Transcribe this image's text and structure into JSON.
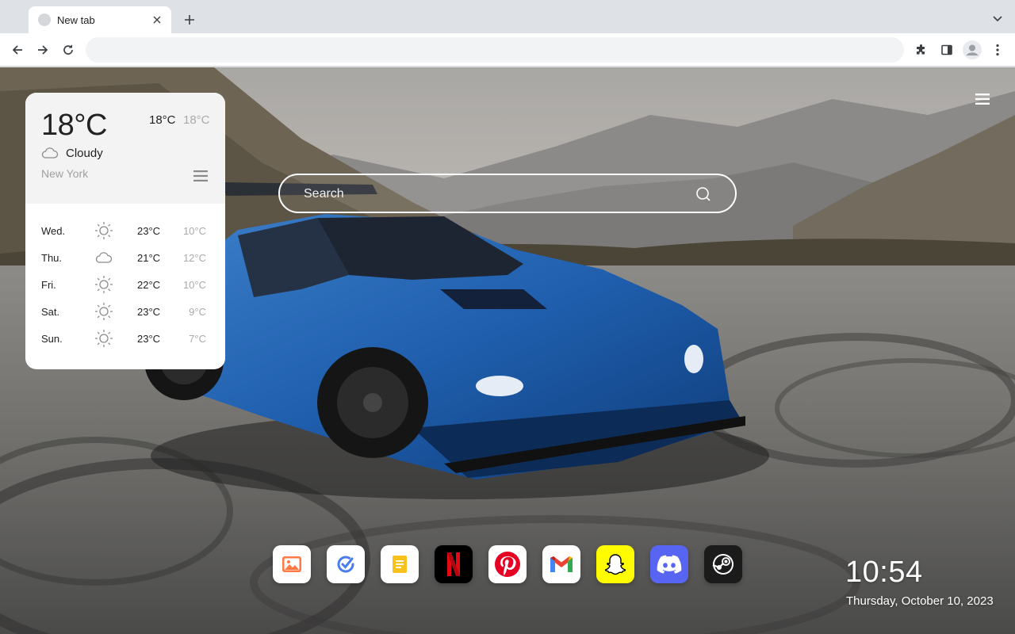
{
  "browser": {
    "tab_title": "New tab",
    "omnibox_value": "",
    "icons": [
      "back-icon",
      "forward-icon",
      "reload-icon",
      "extensions-icon",
      "side-panel-icon",
      "profile-icon",
      "more-icon"
    ]
  },
  "weather": {
    "current_temp": "18°C",
    "high": "18°C",
    "low": "18°C",
    "condition": "Cloudy",
    "condition_icon": "cloud-icon",
    "city": "New York",
    "forecast": [
      {
        "day": "Wed.",
        "icon": "sun-icon",
        "high": "23°C",
        "low": "10°C"
      },
      {
        "day": "Thu.",
        "icon": "cloud-icon",
        "high": "21°C",
        "low": "12°C"
      },
      {
        "day": "Fri.",
        "icon": "sun-icon",
        "high": "22°C",
        "low": "10°C"
      },
      {
        "day": "Sat.",
        "icon": "sun-icon",
        "high": "23°C",
        "low": "9°C"
      },
      {
        "day": "Sun.",
        "icon": "sun-icon",
        "high": "23°C",
        "low": "7°C"
      }
    ]
  },
  "search": {
    "placeholder": "Search"
  },
  "dock": [
    {
      "name": "gallery",
      "icon": "photos-app-icon",
      "color": "#ff6a3d"
    },
    {
      "name": "tasks",
      "icon": "tasks-app-icon",
      "color": "#4a7cf0"
    },
    {
      "name": "notes",
      "icon": "notes-app-icon",
      "color": "#f2b400"
    },
    {
      "name": "netflix",
      "icon": "netflix-icon",
      "color": "#e50914"
    },
    {
      "name": "pinterest",
      "icon": "pinterest-icon",
      "color": "#e60023"
    },
    {
      "name": "gmail",
      "icon": "gmail-icon",
      "color": "#ea4335"
    },
    {
      "name": "snapchat",
      "icon": "snapchat-icon",
      "color": "#fffc00"
    },
    {
      "name": "discord",
      "icon": "discord-icon",
      "color": "#5865f2"
    },
    {
      "name": "steam",
      "icon": "steam-icon",
      "color": "#171a21"
    }
  ],
  "clock": {
    "time": "10:54",
    "date": "Thursday, October 10, 2023"
  }
}
